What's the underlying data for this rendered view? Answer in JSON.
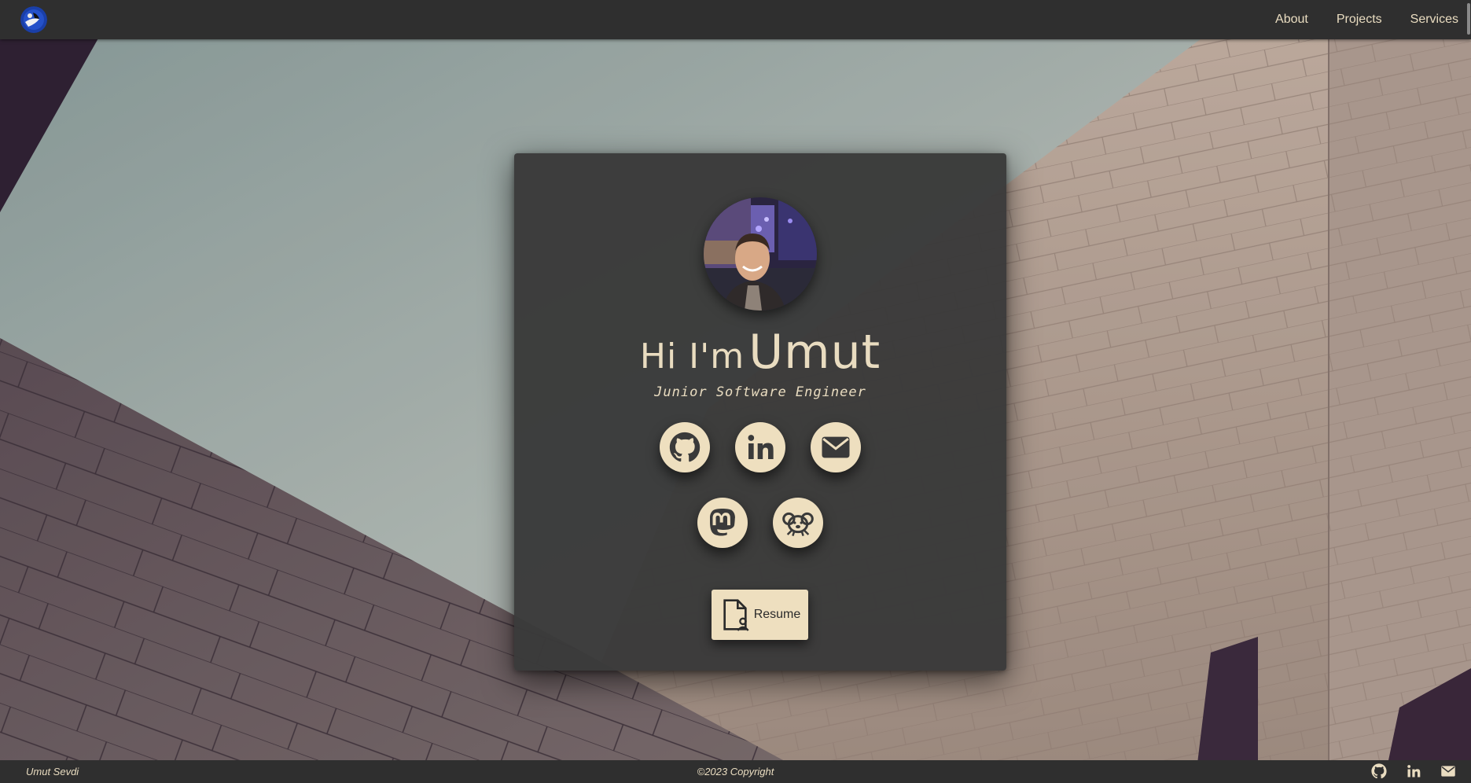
{
  "nav": {
    "links": [
      "About",
      "Projects",
      "Services"
    ]
  },
  "hero": {
    "greeting": "Hi I'm",
    "name": "Umut",
    "subtitle": "Junior Software Engineer",
    "resume_label": "Resume"
  },
  "social": [
    {
      "icon": "github-icon"
    },
    {
      "icon": "linkedin-icon"
    },
    {
      "icon": "mail-icon"
    },
    {
      "icon": "mastodon-icon"
    },
    {
      "icon": "koala-icon"
    }
  ],
  "footer": {
    "name": "Umut Sevdi",
    "copyright": "©2023 Copyright"
  },
  "colors": {
    "accent": "#eedfbf",
    "bar": "#2f2f2f",
    "card": "#3a3a3a",
    "text_dark": "#2b2b2b"
  }
}
